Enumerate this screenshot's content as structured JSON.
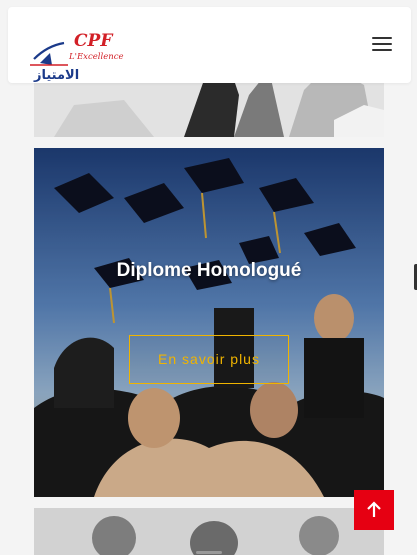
{
  "header": {
    "logo": {
      "brand": "CPF",
      "tagline": "L'Excellence",
      "arabic": "الامتياز"
    },
    "menu_icon": "hamburger-menu-icon"
  },
  "hero": {
    "title": "Diplome Homologué",
    "button_label": "En savoir plus"
  },
  "back_to_top": {
    "icon": "arrow-up-icon"
  },
  "colors": {
    "accent": "#f0b400",
    "back_to_top": "#e60012",
    "logo_red": "#d21f26",
    "logo_blue": "#1b3a8a"
  }
}
